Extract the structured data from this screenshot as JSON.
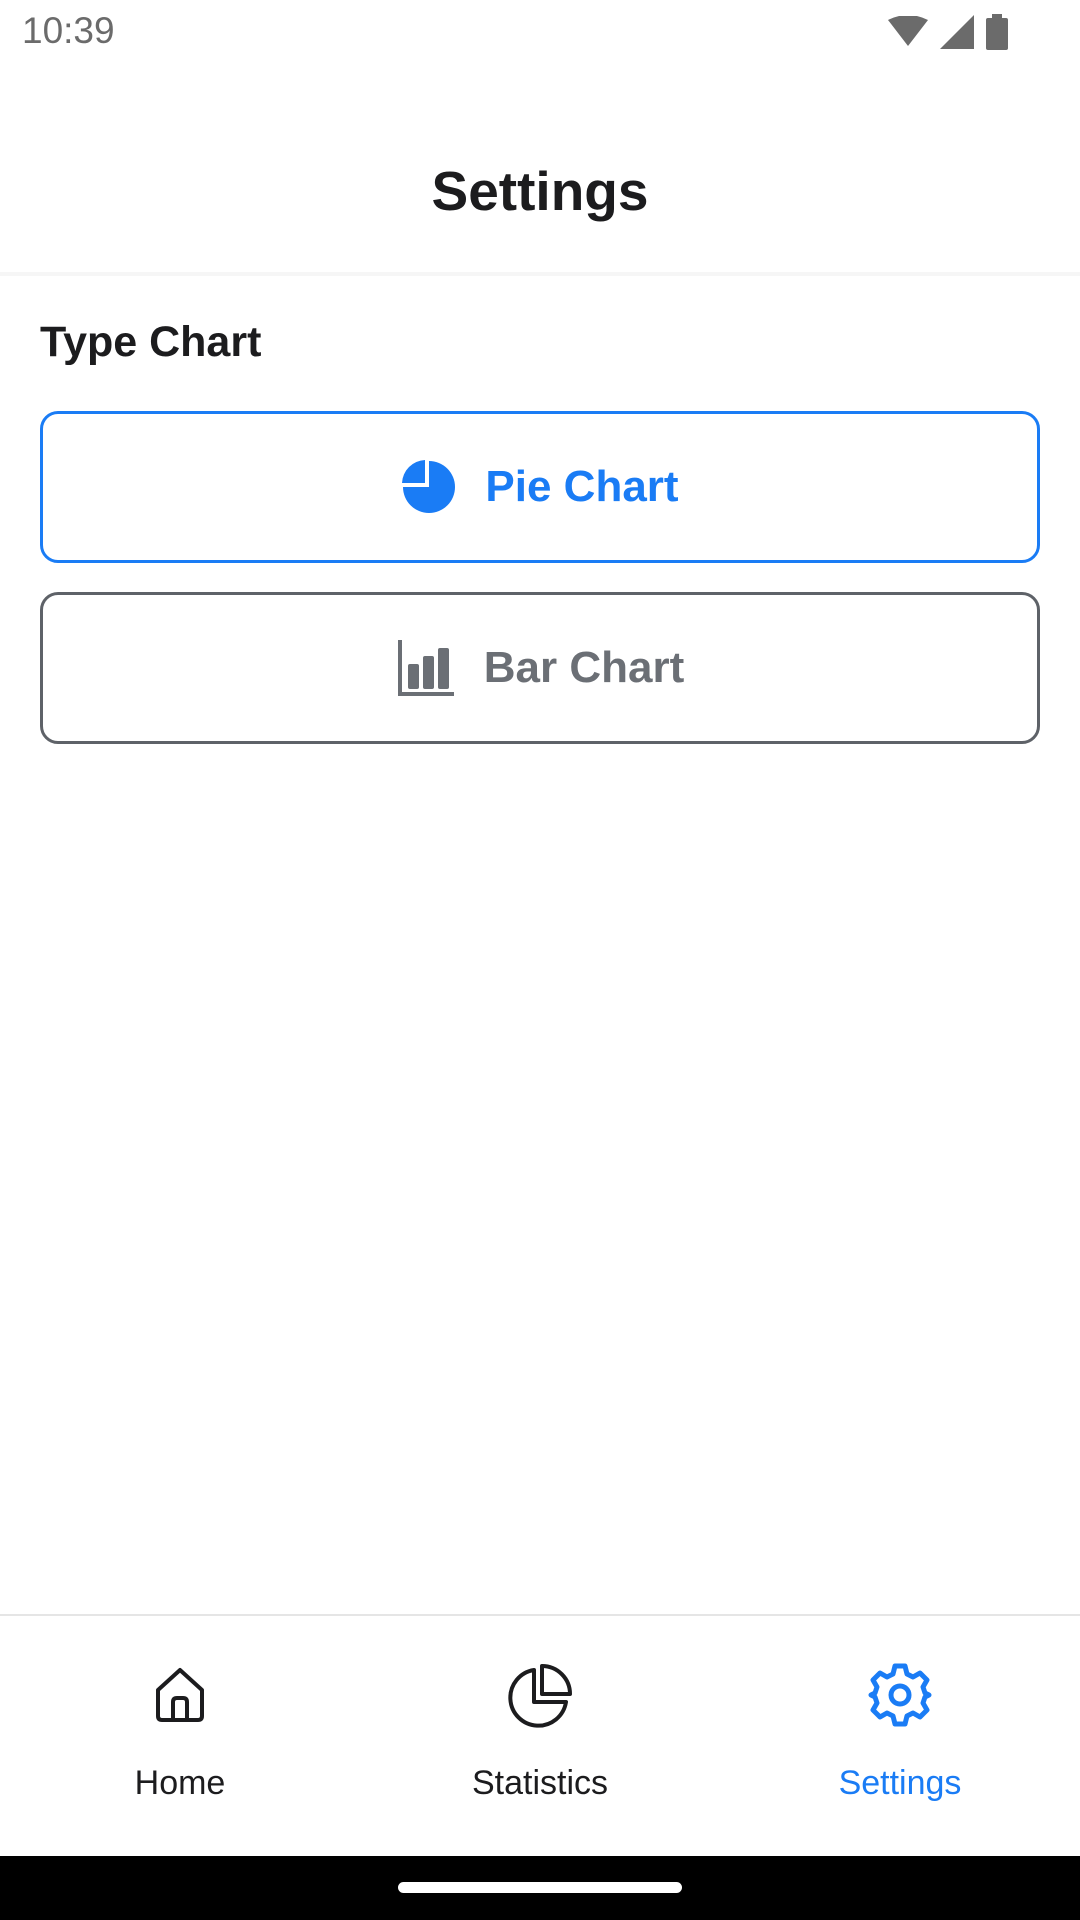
{
  "status_bar": {
    "time": "10:39",
    "icons": [
      "wifi-icon",
      "signal-icon",
      "battery-icon"
    ]
  },
  "header": {
    "title": "Settings"
  },
  "section": {
    "label": "Type Chart"
  },
  "options": [
    {
      "label": "Pie Chart",
      "icon": "pie-chart-icon",
      "selected": true
    },
    {
      "label": "Bar Chart",
      "icon": "bar-chart-icon",
      "selected": false
    }
  ],
  "bottom_nav": {
    "items": [
      {
        "label": "Home",
        "icon": "home-icon",
        "active": false
      },
      {
        "label": "Statistics",
        "icon": "statistics-icon",
        "active": false
      },
      {
        "label": "Settings",
        "icon": "gear-icon",
        "active": true
      }
    ]
  },
  "colors": {
    "accent": "#1a7cf5",
    "inactive_border": "#5e6268",
    "inactive_text": "#6b6f75",
    "text": "#1c1c1e"
  }
}
